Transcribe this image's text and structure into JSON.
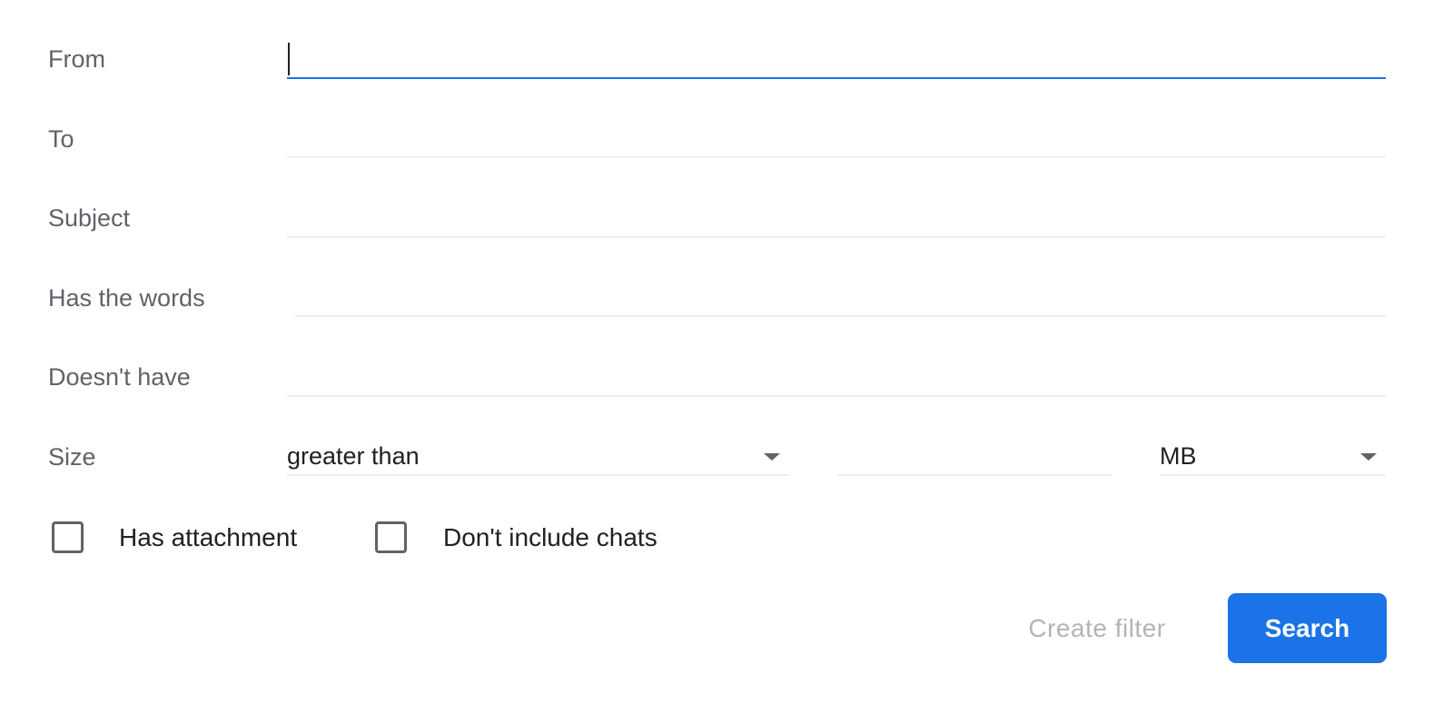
{
  "fields": {
    "from": {
      "label": "From",
      "value": ""
    },
    "to": {
      "label": "To",
      "value": ""
    },
    "subject": {
      "label": "Subject",
      "value": ""
    },
    "has_words": {
      "label": "Has the words",
      "value": ""
    },
    "doesnt_have": {
      "label": "Doesn't have",
      "value": ""
    }
  },
  "size": {
    "label": "Size",
    "operator": "greater than",
    "value": "",
    "unit": "MB"
  },
  "checkboxes": {
    "has_attachment": {
      "label": "Has attachment",
      "checked": false
    },
    "exclude_chats": {
      "label": "Don't include chats",
      "checked": false
    }
  },
  "buttons": {
    "create_filter": "Create filter",
    "search": "Search"
  },
  "colors": {
    "accent": "#1a73e8",
    "label": "#5f6368",
    "disabled": "#b4b4b4"
  }
}
